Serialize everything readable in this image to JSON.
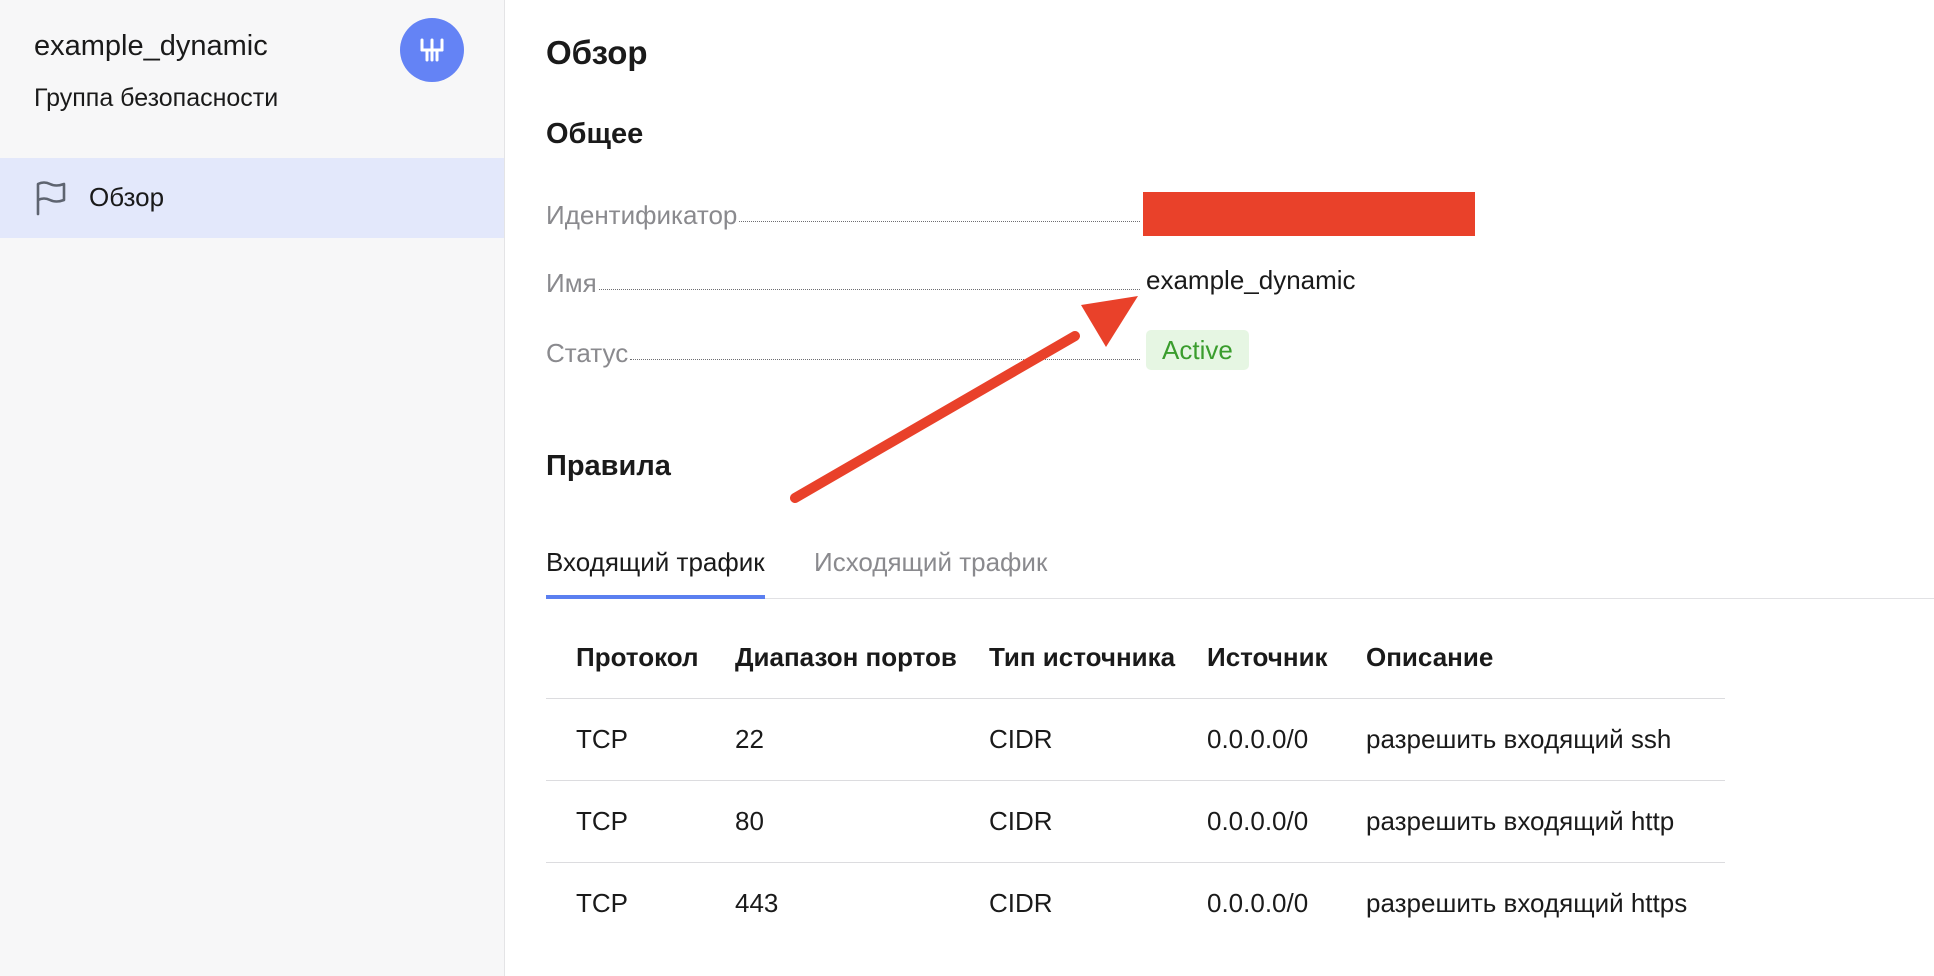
{
  "sidebar": {
    "title": "example_dynamic",
    "subtitle": "Группа безопасности",
    "service_icon": "vpc-network-icon",
    "items": [
      {
        "label": "Обзор",
        "icon": "flag-icon",
        "active": true
      }
    ]
  },
  "main": {
    "title": "Обзор",
    "general": {
      "heading": "Общее",
      "rows": [
        {
          "label": "Идентификатор",
          "value": ""
        },
        {
          "label": "Имя",
          "value": "example_dynamic"
        },
        {
          "label": "Статус",
          "value": "Active"
        }
      ]
    },
    "rules": {
      "heading": "Правила",
      "tabs": [
        {
          "label": "Входящий трафик",
          "active": true
        },
        {
          "label": "Исходящий трафик",
          "active": false
        }
      ],
      "columns": [
        "Протокол",
        "Диапазон портов",
        "Тип источника",
        "Источник",
        "Описание"
      ],
      "rows": [
        [
          "TCP",
          "22",
          "CIDR",
          "0.0.0.0/0",
          "разрешить входящий ssh"
        ],
        [
          "TCP",
          "80",
          "CIDR",
          "0.0.0.0/0",
          "разрешить входящий http"
        ],
        [
          "TCP",
          "443",
          "CIDR",
          "0.0.0.0/0",
          "разрешить входящий https"
        ]
      ]
    }
  },
  "colors": {
    "accent": "#5b7ff0",
    "service_icon_bg": "#6483f5",
    "active_nav_bg": "#e3e8fb",
    "status_active_text": "#3a9d2d",
    "status_active_bg": "#e6f6e3",
    "redaction": "#e9412a",
    "annotation_arrow": "#e9412a"
  }
}
